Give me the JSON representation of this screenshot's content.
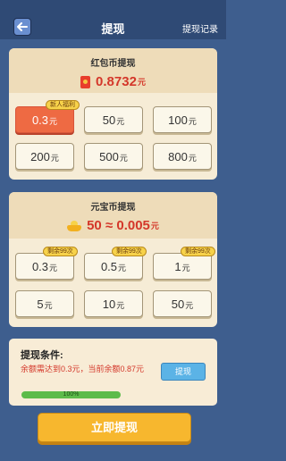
{
  "header": {
    "title": "提现",
    "record_label": "提现记录"
  },
  "hongbao": {
    "title": "红包币提现",
    "balance": "0.8732",
    "balance_unit": "元",
    "options": [
      {
        "value": "0.3",
        "unit": "元",
        "tag": "新人福利",
        "selected": true
      },
      {
        "value": "50",
        "unit": "元"
      },
      {
        "value": "100",
        "unit": "元"
      },
      {
        "value": "200",
        "unit": "元"
      },
      {
        "value": "500",
        "unit": "元"
      },
      {
        "value": "800",
        "unit": "元"
      }
    ]
  },
  "yuanbao": {
    "title": "元宝币提现",
    "rate": "50 ≈ 0.005",
    "rate_unit": "元",
    "options": [
      {
        "value": "0.3",
        "unit": "元",
        "tag": "剩余99次"
      },
      {
        "value": "0.5",
        "unit": "元",
        "tag": "剩余99次"
      },
      {
        "value": "1",
        "unit": "元",
        "tag": "剩余99次"
      },
      {
        "value": "5",
        "unit": "元"
      },
      {
        "value": "10",
        "unit": "元"
      },
      {
        "value": "50",
        "unit": "元"
      }
    ]
  },
  "condition": {
    "title": "提现条件:",
    "text": "余额需达到0.3元，当前余额0.87元",
    "button_label": "提现",
    "progress_label": "100%",
    "progress_value": 1.0
  },
  "main_button_label": "立即提现",
  "colors": {
    "accent_orange": "#ee6a43",
    "money_red": "#d4372a",
    "header_blue": "#2f4a75",
    "bg_blue": "#3e5e8e"
  },
  "icons": {
    "back": "back-arrow-icon",
    "hongbao": "red-envelope-icon",
    "yuanbao": "gold-ingot-icon"
  }
}
